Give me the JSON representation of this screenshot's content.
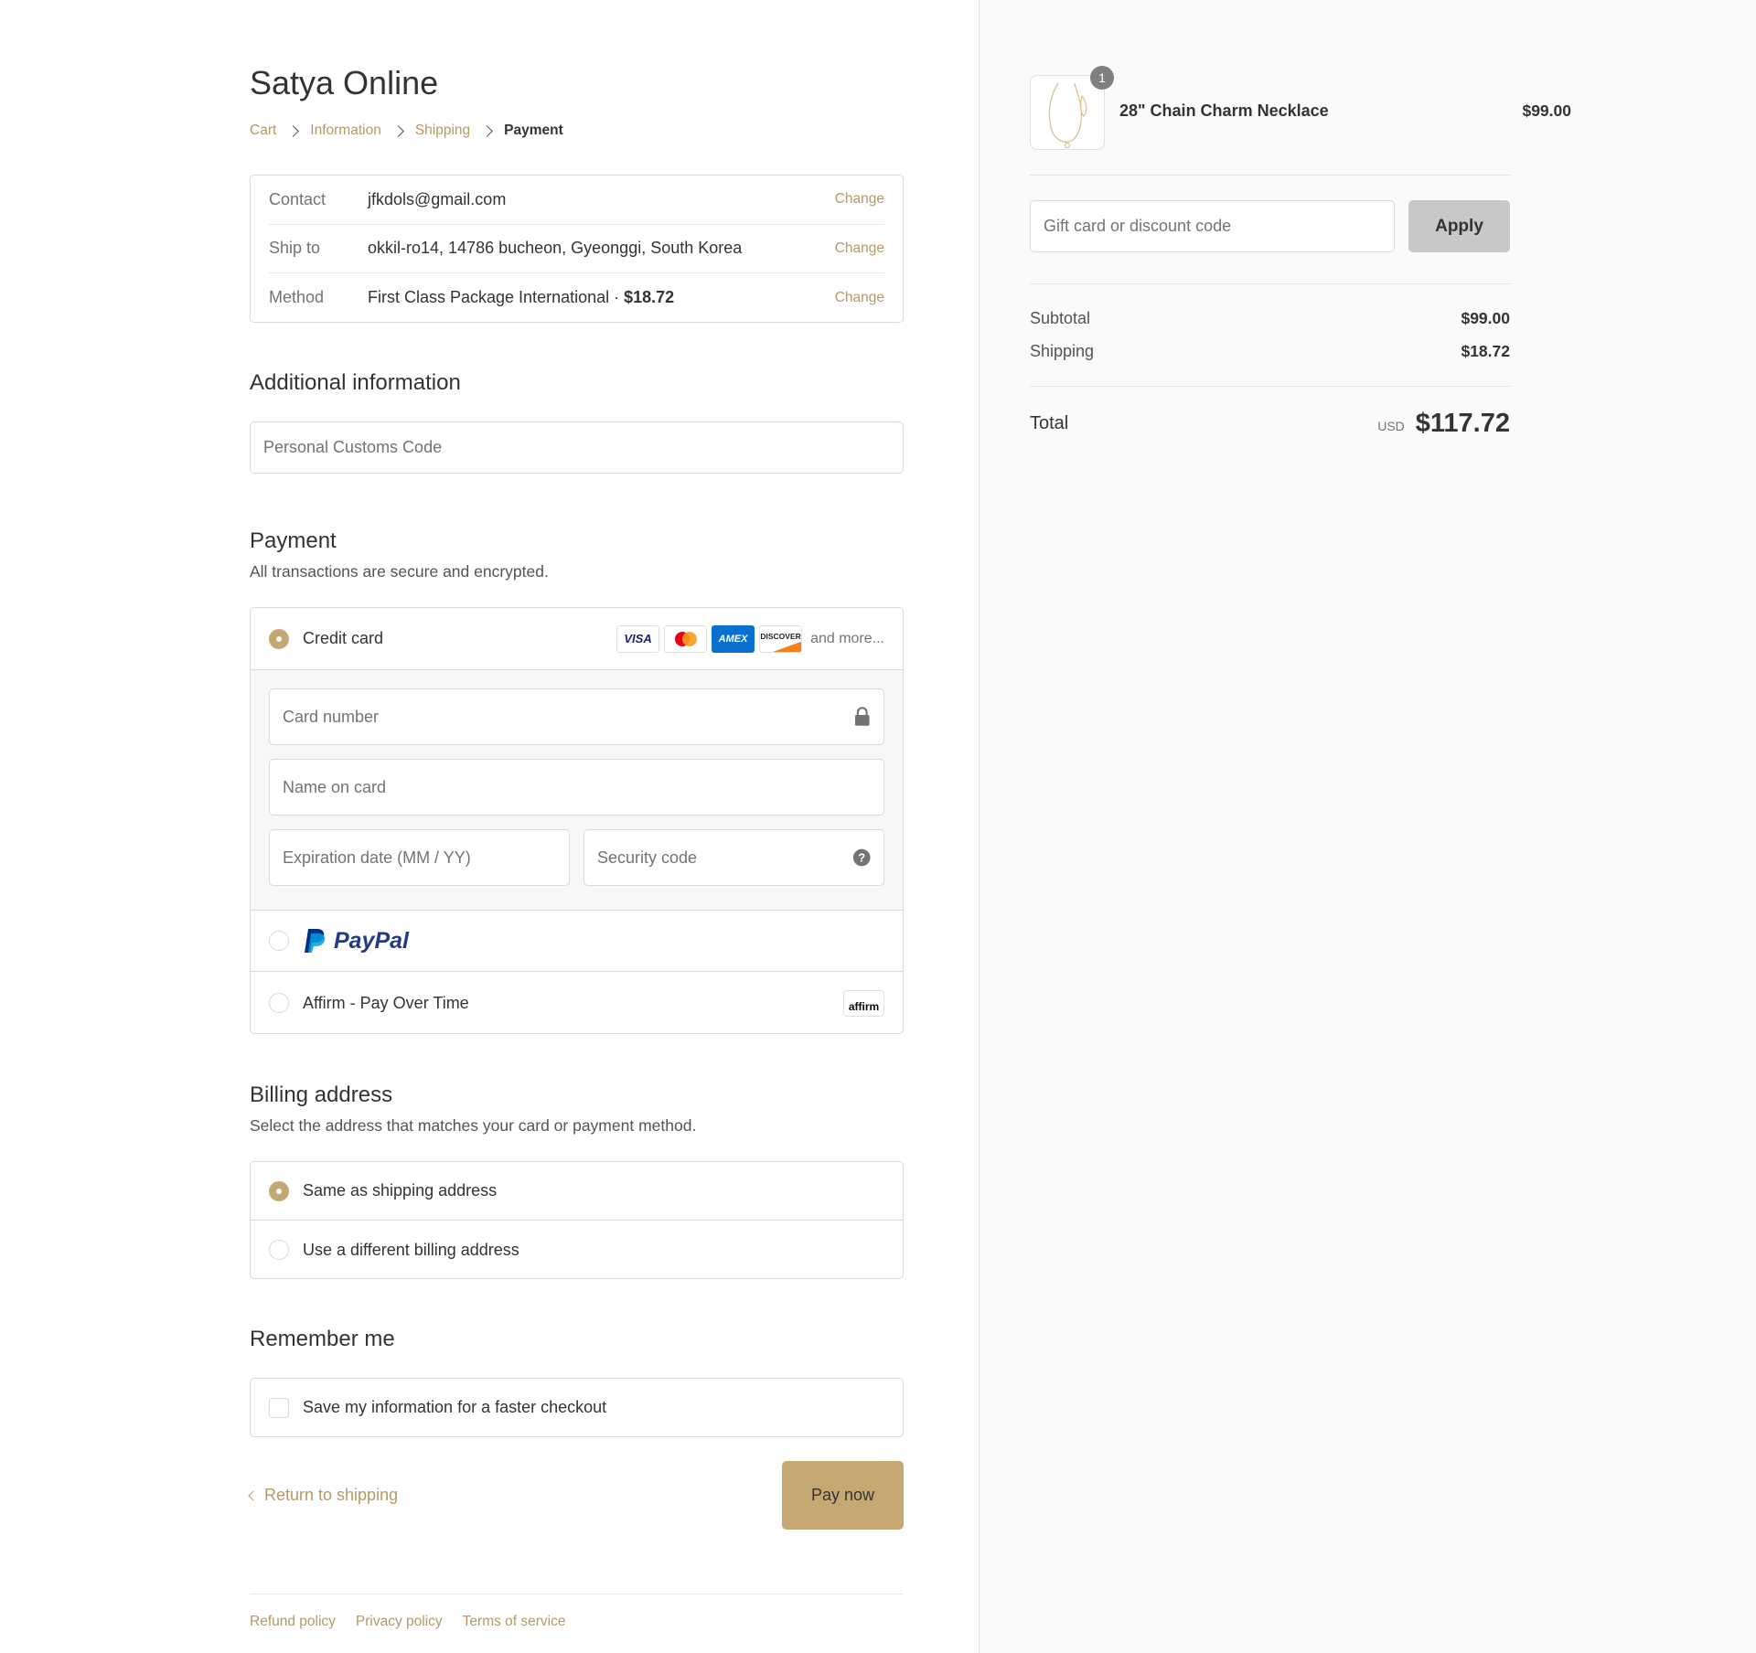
{
  "shop_name": "Satya Online",
  "breadcrumb": {
    "cart": "Cart",
    "information": "Information",
    "shipping": "Shipping",
    "payment": "Payment"
  },
  "review": {
    "change_label": "Change",
    "contact": {
      "label": "Contact",
      "value": "jfkdols@gmail.com"
    },
    "ship_to": {
      "label": "Ship to",
      "value": "okkil-ro14, 14786 bucheon, Gyeonggi, South Korea"
    },
    "method": {
      "label": "Method",
      "value": "First Class Package International · ",
      "price": "$18.72"
    }
  },
  "additional_info": {
    "heading": "Additional information",
    "customs_placeholder": "Personal Customs Code"
  },
  "payment": {
    "heading": "Payment",
    "subtext": "All transactions are secure and encrypted.",
    "credit_card_label": "Credit card",
    "card_brands": [
      "VISA",
      "mastercard",
      "AMEX",
      "DISCOVER"
    ],
    "and_more": "and more...",
    "card_number_placeholder": "Card number",
    "name_on_card_placeholder": "Name on card",
    "expiration_placeholder": "Expiration date (MM / YY)",
    "security_code_placeholder": "Security code",
    "paypal_label": "PayPal",
    "affirm_label": "Affirm - Pay Over Time",
    "affirm_logo": "affirm",
    "selected": "credit-card"
  },
  "billing": {
    "heading": "Billing address",
    "subtext": "Select the address that matches your card or payment method.",
    "same_label": "Same as shipping address",
    "different_label": "Use a different billing address",
    "selected": "same"
  },
  "remember": {
    "heading": "Remember me",
    "checkbox_label": "Save my information for a faster checkout",
    "checked": false
  },
  "actions": {
    "return_label": "Return to shipping",
    "pay_label": "Pay now"
  },
  "footer": {
    "refund": "Refund policy",
    "privacy": "Privacy policy",
    "terms": "Terms of service"
  },
  "summary": {
    "product": {
      "name": "28\" Chain Charm Necklace",
      "price": "$99.00",
      "quantity": "1"
    },
    "discount_placeholder": "Gift card or discount code",
    "apply_label": "Apply",
    "subtotal_label": "Subtotal",
    "subtotal_value": "$99.00",
    "shipping_label": "Shipping",
    "shipping_value": "$18.72",
    "total_label": "Total",
    "currency": "USD",
    "total_value": "$117.72"
  },
  "colors": {
    "accent": "#b79863",
    "button": "#c6a972",
    "sidebar_bg": "#fafafa"
  }
}
